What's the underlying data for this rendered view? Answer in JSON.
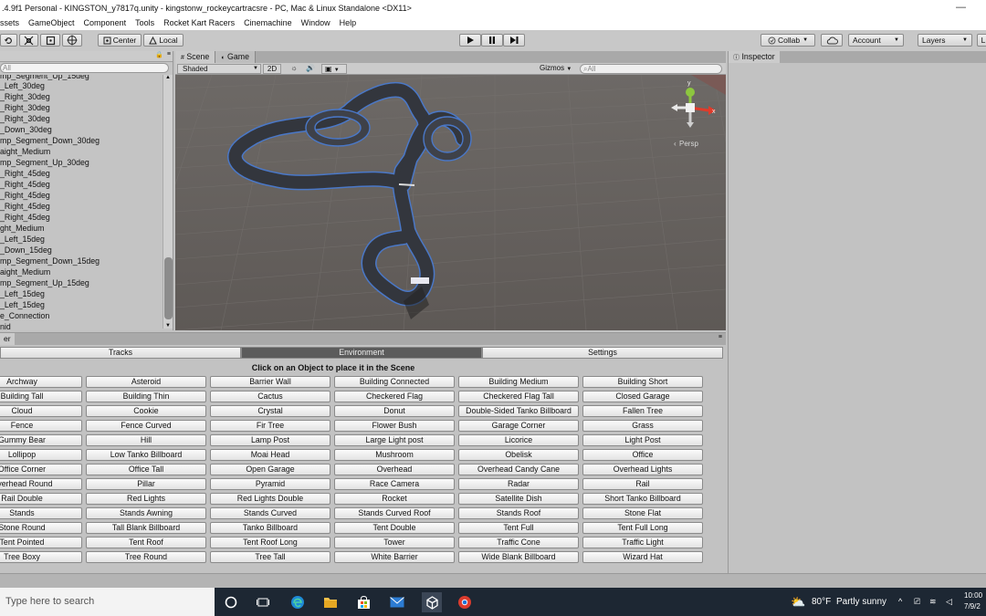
{
  "window": {
    "title": ".4.9f1 Personal - KINGSTON_y7817q.unity - kingstonw_rockeycartracsre - PC, Mac & Linux Standalone <DX11>",
    "minimize_glyph": "—"
  },
  "menu": [
    "ssets",
    "GameObject",
    "Component",
    "Tools",
    "Rocket Kart Racers",
    "Cinemachine",
    "Window",
    "Help"
  ],
  "toolbar": {
    "center_label": "Center",
    "local_label": "Local",
    "collab_label": "Collab",
    "account_label": "Account",
    "layers_label": "Layers",
    "cut_label": "L"
  },
  "hierarchy": {
    "search_placeholder": "All",
    "items": [
      "mp_Segment_Up_15deg",
      "_Left_30deg",
      "_Right_30deg",
      "_Right_30deg",
      "_Right_30deg",
      "_Down_30deg",
      "mp_Segment_Down_30deg",
      "aight_Medium",
      "mp_Segment_Up_30deg",
      "_Right_45deg",
      "_Right_45deg",
      "_Right_45deg",
      "_Right_45deg",
      "_Right_45deg",
      "ght_Medium",
      "_Left_15deg",
      "_Down_15deg",
      "mp_Segment_Down_15deg",
      "aight_Medium",
      "mp_Segment_Up_15deg",
      "_Left_15deg",
      "_Left_15deg",
      "e_Connection",
      "nid"
    ]
  },
  "scene": {
    "tab_scene": "Scene",
    "tab_game": "Game",
    "shading": "Shaded",
    "mode_2d": "2D",
    "gizmos": "Gizmos",
    "search_placeholder": "All",
    "persp_label": "Persp",
    "axis_y": "y",
    "axis_x": "x"
  },
  "inspector": {
    "tab": "Inspector"
  },
  "placer": {
    "panel_tab": "er",
    "tabs": [
      "Tracks",
      "Environment",
      "Settings"
    ],
    "active_tab": "Environment",
    "instruction": "Click on an Object to place it in the Scene",
    "objects": [
      "Archway",
      "Asteroid",
      "Barrier Wall",
      "Building Connected",
      "Building Medium",
      "Building Short",
      "Building Tall",
      "Building Thin",
      "Cactus",
      "Checkered Flag",
      "Checkered Flag Tall",
      "Closed Garage",
      "Cloud",
      "Cookie",
      "Crystal",
      "Donut",
      "Double-Sided Tanko Billboard",
      "Fallen Tree",
      "Fence",
      "Fence Curved",
      "Fir Tree",
      "Flower Bush",
      "Garage Corner",
      "Grass",
      "Gummy Bear",
      "Hill",
      "Lamp Post",
      "Large Light post",
      "Licorice",
      "Light Post",
      "Lollipop",
      "Low Tanko Billboard",
      "Moai Head",
      "Mushroom",
      "Obelisk",
      "Office",
      "Office Corner",
      "Office Tall",
      "Open Garage",
      "Overhead",
      "Overhead Candy Cane",
      "Overhead Lights",
      "Overhead Round",
      "Pillar",
      "Pyramid",
      "Race Camera",
      "Radar",
      "Rail",
      "Rail Double",
      "Red Lights",
      "Red Lights Double",
      "Rocket",
      "Satellite Dish",
      "Short Tanko Billboard",
      "Stands",
      "Stands Awning",
      "Stands Curved",
      "Stands Curved Roof",
      "Stands Roof",
      "Stone Flat",
      "Stone Round",
      "Tall Blank Billboard",
      "Tanko Billboard",
      "Tent Double",
      "Tent Full",
      "Tent Full Long",
      "Tent Pointed",
      "Tent Roof",
      "Tent Roof Long",
      "Tower",
      "Traffic Cone",
      "Traffic Light",
      "Tree Boxy",
      "Tree Round",
      "Tree Tall",
      "White Barrier",
      "Wide Blank Billboard",
      "Wizard Hat"
    ]
  },
  "taskbar": {
    "search_placeholder": "Type here to search",
    "weather_temp": "80°F",
    "weather_desc": "Partly sunny",
    "time": "10:00",
    "date": "7/9/2"
  }
}
